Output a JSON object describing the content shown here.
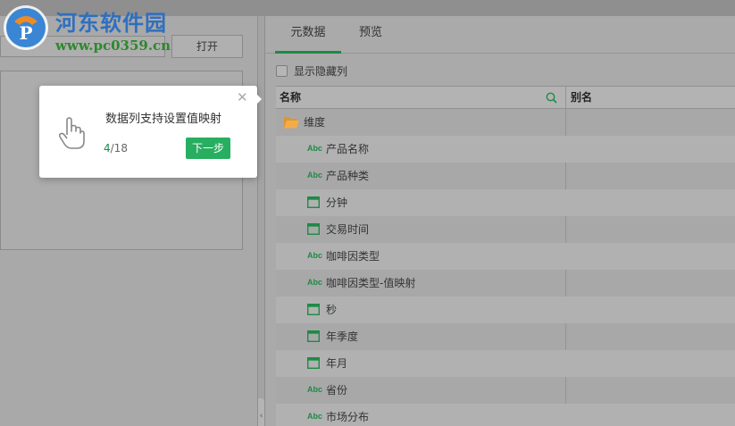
{
  "watermark": {
    "title": "河东软件园",
    "url": "www.pc0359.cn"
  },
  "left": {
    "open_button": "打开"
  },
  "tabs": [
    {
      "label": "元数据",
      "active": true
    },
    {
      "label": "预览",
      "active": false
    }
  ],
  "show_hidden_columns": {
    "label": "显示隐藏列",
    "checked": false
  },
  "table": {
    "headers": {
      "name": "名称",
      "alias": "别名"
    },
    "dimension_folder": "维度",
    "items": [
      {
        "icon": "abc-icon",
        "label": "产品名称"
      },
      {
        "icon": "calendar-icon",
        "label": "分钟"
      },
      {
        "icon": "abc-icon",
        "label": "咖啡因类型"
      },
      {
        "icon": "calendar-icon",
        "label": "秒"
      },
      {
        "icon": "calendar-icon",
        "label": "年月"
      },
      {
        "icon": "abc-icon",
        "label": "市场分布"
      }
    ],
    "items_plain": [
      {
        "icon": "abc-icon",
        "label": "产品种类"
      },
      {
        "icon": "calendar-icon",
        "label": "交易时间"
      },
      {
        "icon": "abc-icon",
        "label": "咖啡因类型-值映射"
      },
      {
        "icon": "calendar-icon",
        "label": "年季度"
      },
      {
        "icon": "abc-icon",
        "label": "省份"
      }
    ],
    "abc_text": "Abc"
  },
  "popup": {
    "message": "数据列支持设置值映射",
    "step_current": "4",
    "step_total": "/18",
    "next_label": "下一步",
    "close_glyph": "✕"
  },
  "colors": {
    "accent": "#27ae60",
    "tab_underline": "#1e8a46",
    "folder": "#f0a63b"
  }
}
